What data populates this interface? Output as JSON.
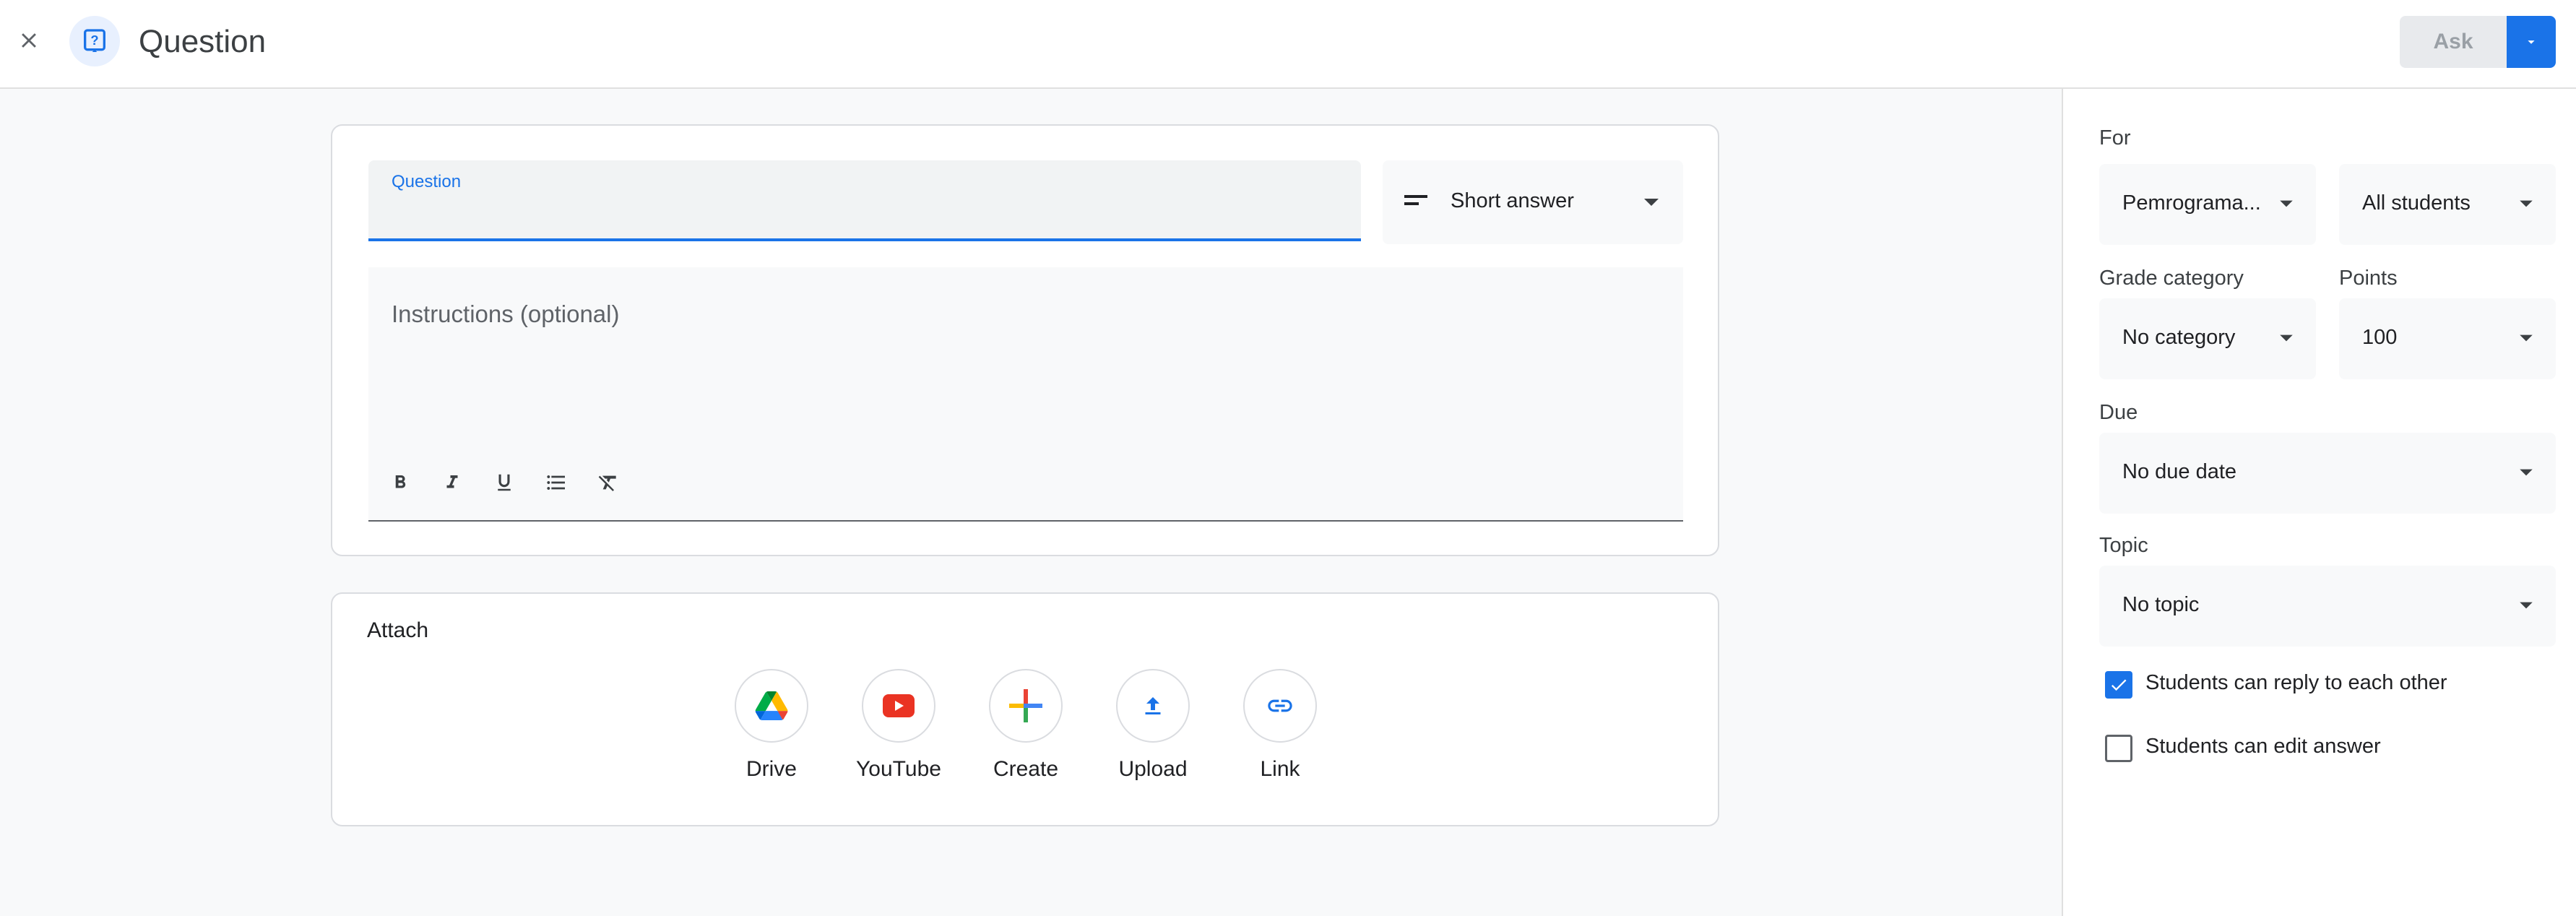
{
  "header": {
    "title": "Question",
    "ask_label": "Ask"
  },
  "question": {
    "label": "Question",
    "value": ""
  },
  "answer_type": {
    "selected": "Short answer"
  },
  "instructions": {
    "placeholder": "Instructions (optional)",
    "format_tools": [
      "bold",
      "italic",
      "underline",
      "bulleted-list",
      "clear-formatting"
    ]
  },
  "attach": {
    "title": "Attach",
    "items": [
      {
        "label": "Drive",
        "icon": "drive-icon"
      },
      {
        "label": "YouTube",
        "icon": "youtube-icon"
      },
      {
        "label": "Create",
        "icon": "create-icon"
      },
      {
        "label": "Upload",
        "icon": "upload-icon"
      },
      {
        "label": "Link",
        "icon": "link-icon"
      }
    ]
  },
  "panel": {
    "for_label": "For",
    "class_value": "Pemrograma...",
    "students_value": "All students",
    "grade_category_label": "Grade category",
    "grade_category_value": "No category",
    "points_label": "Points",
    "points_value": "100",
    "due_label": "Due",
    "due_value": "No due date",
    "topic_label": "Topic",
    "topic_value": "No topic",
    "reply_label": "Students can reply to each other",
    "reply_checked": true,
    "edit_label": "Students can edit answer",
    "edit_checked": false
  },
  "colors": {
    "accent": "#1a73e8",
    "youtube": "#ff0000"
  }
}
